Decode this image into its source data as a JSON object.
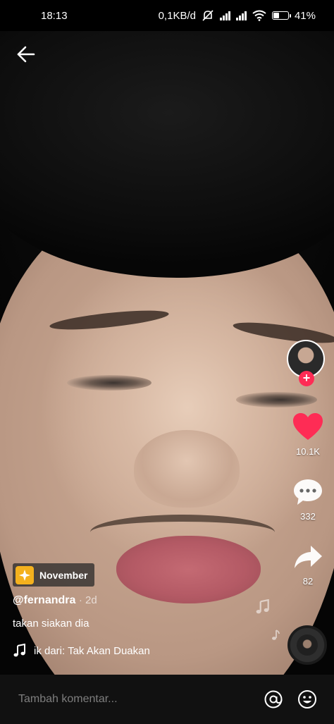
{
  "status_bar": {
    "time": "18:13",
    "net_speed": "0,1KB/d",
    "battery_pct": "41%",
    "battery_level": 0.41
  },
  "nav": {
    "back_icon": "arrow-left-icon"
  },
  "video": {
    "sticker_tag": "November",
    "author": "@fernandra",
    "age": "· 2d",
    "caption": "takan siakan dia",
    "music": "ik dari: Tak Akan Duakan"
  },
  "actions": {
    "likes": "10.1K",
    "comments": "332",
    "shares": "82",
    "like_color": "#fe2c55",
    "follow_color": "#fe2c55"
  },
  "comment_bar": {
    "placeholder": "Tambah komentar..."
  }
}
